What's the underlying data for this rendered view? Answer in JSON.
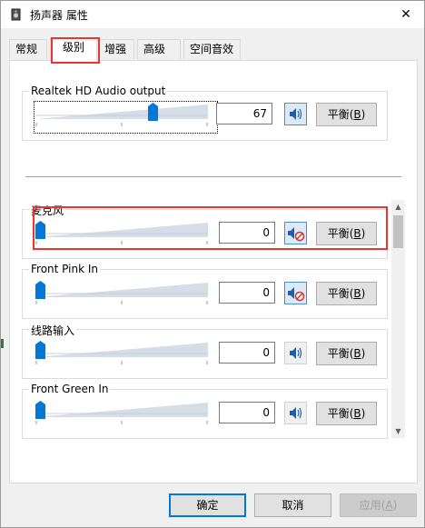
{
  "window": {
    "title": "扬声器 属性",
    "close_glyph": "✕",
    "icon": "speaker-icon"
  },
  "tabs": [
    {
      "label": "常规"
    },
    {
      "label": "级别"
    },
    {
      "label": "增强"
    },
    {
      "label": "高级"
    },
    {
      "label": "空间音效"
    }
  ],
  "active_tab": "级别",
  "main_output": {
    "label": "Realtek HD Audio output",
    "value": "67",
    "level_fraction": 0.67,
    "speaker_icon": "speaker-volume-icon",
    "balance_label": "平衡(",
    "balance_key": "B",
    "balance_suffix": ")"
  },
  "channels": [
    {
      "label": "麦克风",
      "value": "0",
      "level_fraction": 0.0,
      "muted": true,
      "speaker_icon": "speaker-muted-icon",
      "balance_label": "平衡(",
      "balance_key": "B",
      "balance_suffix": ")"
    },
    {
      "label": "Front Pink In",
      "value": "0",
      "level_fraction": 0.0,
      "muted": true,
      "speaker_icon": "speaker-muted-icon",
      "balance_label": "平衡(",
      "balance_key": "B",
      "balance_suffix": ")"
    },
    {
      "label": "线路输入",
      "value": "0",
      "level_fraction": 0.0,
      "muted": false,
      "speaker_icon": "speaker-volume-icon",
      "balance_label": "平衡(",
      "balance_key": "B",
      "balance_suffix": ")"
    },
    {
      "label": "Front Green In",
      "value": "0",
      "level_fraction": 0.0,
      "muted": false,
      "speaker_icon": "speaker-volume-icon",
      "balance_label": "平衡(",
      "balance_key": "B",
      "balance_suffix": ")"
    }
  ],
  "footer": {
    "ok_label": "确定",
    "cancel_label": "取消",
    "apply_label": "应用(",
    "apply_key": "A",
    "apply_suffix": ")"
  },
  "colors": {
    "accent": "#0078d7",
    "highlight_red": "#e33333",
    "mute_red": "#d32f2f"
  }
}
